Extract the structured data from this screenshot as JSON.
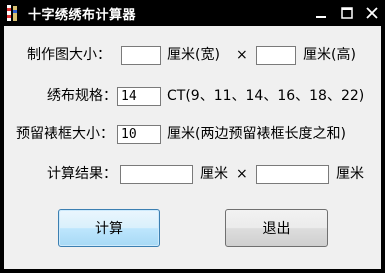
{
  "window": {
    "title": "十字绣绣布计算器",
    "controls": {
      "minimize": "—",
      "maximize": "☐",
      "close": "✕"
    }
  },
  "form": {
    "size": {
      "label": "制作图大小：",
      "width_value": "",
      "width_unit": "厘米(宽)",
      "times": "×",
      "height_value": "",
      "height_unit": "厘米(高)"
    },
    "fabric": {
      "label": "绣布规格：",
      "value": "14",
      "hint": "CT(9、11、14、16、18、22)"
    },
    "margin": {
      "label": "预留裱框大小：",
      "value": "10",
      "hint": "厘米(两边预留裱框长度之和)"
    },
    "result": {
      "label": "计算结果：",
      "width_value": "",
      "width_unit": "厘米",
      "times": "×",
      "height_value": "",
      "height_unit": "厘米"
    }
  },
  "buttons": {
    "calculate": "计算",
    "exit": "退出"
  },
  "colors": {
    "titlebar": "#000000",
    "client_bg": "#f0f0f0",
    "calc_button": "#bee6fd",
    "exit_button": "#dddddd"
  }
}
